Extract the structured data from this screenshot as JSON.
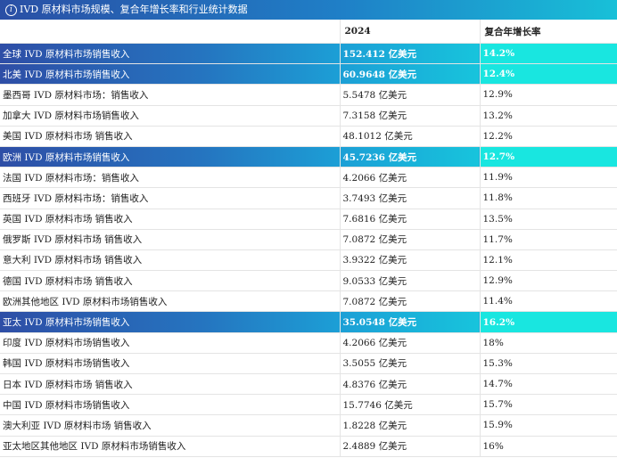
{
  "title": "IVD 原材料市场规模、复合年增长率和行业统计数据",
  "header": {
    "region": "",
    "year": "2024",
    "cagr": "复合年增长率"
  },
  "rows": [
    {
      "region": "全球 IVD 原材料市场销售收入",
      "value": "152.412 亿美元",
      "cagr": "14.2%",
      "highlight": true
    },
    {
      "region": "北美 IVD 原材料市场销售收入",
      "value": "60.9648 亿美元",
      "cagr": "12.4%",
      "highlight": true
    },
    {
      "region": "墨西哥 IVD 原材料市场：销售收入",
      "value": "5.5478 亿美元",
      "cagr": "12.9%",
      "highlight": false
    },
    {
      "region": "加拿大 IVD 原材料市场销售收入",
      "value": "7.3158 亿美元",
      "cagr": "13.2%",
      "highlight": false
    },
    {
      "region": "美国 IVD 原材料市场 销售收入",
      "value": "48.1012 亿美元",
      "cagr": "12.2%",
      "highlight": false
    },
    {
      "region": "欧洲 IVD 原材料市场销售收入",
      "value": "45.7236 亿美元",
      "cagr": "12.7%",
      "highlight": true
    },
    {
      "region": "法国 IVD 原材料市场：销售收入",
      "value": "4.2066 亿美元",
      "cagr": "11.9%",
      "highlight": false
    },
    {
      "region": "西班牙 IVD 原材料市场：销售收入",
      "value": "3.7493 亿美元",
      "cagr": "11.8%",
      "highlight": false
    },
    {
      "region": "英国 IVD 原材料市场 销售收入",
      "value": "7.6816 亿美元",
      "cagr": "13.5%",
      "highlight": false
    },
    {
      "region": "俄罗斯 IVD 原材料市场 销售收入",
      "value": "7.0872 亿美元",
      "cagr": "11.7%",
      "highlight": false
    },
    {
      "region": "意大利 IVD 原材料市场 销售收入",
      "value": "3.9322 亿美元",
      "cagr": "12.1%",
      "highlight": false
    },
    {
      "region": "德国 IVD 原材料市场 销售收入",
      "value": "9.0533 亿美元",
      "cagr": "12.9%",
      "highlight": false
    },
    {
      "region": "欧洲其他地区 IVD 原材料市场销售收入",
      "value": "7.0872 亿美元",
      "cagr": "11.4%",
      "highlight": false
    },
    {
      "region": "亚太 IVD 原材料市场销售收入",
      "value": "35.0548 亿美元",
      "cagr": "16.2%",
      "highlight": true
    },
    {
      "region": "印度 IVD 原材料市场销售收入",
      "value": "4.2066 亿美元",
      "cagr": "18%",
      "highlight": false
    },
    {
      "region": "韩国 IVD 原材料市场销售收入",
      "value": "3.5055 亿美元",
      "cagr": "15.3%",
      "highlight": false
    },
    {
      "region": "日本 IVD 原材料市场 销售收入",
      "value": "4.8376 亿美元",
      "cagr": "14.7%",
      "highlight": false
    },
    {
      "region": "中国 IVD 原材料市场销售收入",
      "value": "15.7746 亿美元",
      "cagr": "15.7%",
      "highlight": false
    },
    {
      "region": "澳大利亚 IVD 原材料市场 销售收入",
      "value": "1.8228 亿美元",
      "cagr": "15.9%",
      "highlight": false
    },
    {
      "region": "亚太地区其他地区 IVD 原材料市场销售收入",
      "value": "2.4889 亿美元",
      "cagr": "16%",
      "highlight": false
    }
  ]
}
